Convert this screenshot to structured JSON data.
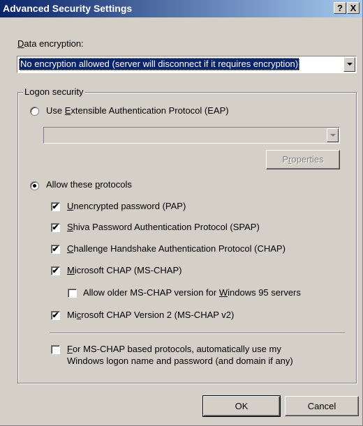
{
  "window": {
    "title": "Advanced Security Settings",
    "help_btn": "?",
    "close_btn": "X"
  },
  "encryption": {
    "label_prefix": "",
    "label_accel": "D",
    "label_rest": "ata encryption:",
    "selected": "No encryption allowed (server will disconnect if it requires encryption)"
  },
  "logon": {
    "legend": "Logon security",
    "eap": {
      "pre": "Use ",
      "accel": "E",
      "post": "xtensible Authentication Protocol (EAP)",
      "checked": false,
      "combo_value": ""
    },
    "properties_btn": {
      "pre": "P",
      "accel": "r",
      "post": "operties"
    },
    "allow": {
      "pre": "Allow these ",
      "accel": "p",
      "post": "rotocols",
      "checked": true
    },
    "protocols": [
      {
        "pre": "",
        "accel": "U",
        "post": "nencrypted password (PAP)",
        "checked": true
      },
      {
        "pre": "",
        "accel": "S",
        "post": "hiva Password Authentication Protocol (SPAP)",
        "checked": true
      },
      {
        "pre": "",
        "accel": "C",
        "post": "hallenge Handshake Authentication Protocol (CHAP)",
        "checked": true
      },
      {
        "pre": "",
        "accel": "M",
        "post": "icrosoft CHAP (MS-CHAP)",
        "checked": true
      },
      {
        "pre": "Allow older MS-CHAP version for ",
        "accel": "W",
        "post": "indows 95 servers",
        "checked": false
      },
      {
        "pre": "Mi",
        "accel": "c",
        "post": "rosoft CHAP Version 2 (MS-CHAP v2)",
        "checked": true
      }
    ],
    "auto_logon": {
      "pre": "",
      "accel": "F",
      "post": "or MS-CHAP based protocols, automatically use my",
      "line2": "Windows logon name and password (and domain if any)",
      "checked": false
    }
  },
  "buttons": {
    "ok": "OK",
    "cancel": "Cancel"
  },
  "check_glyph": "✔"
}
